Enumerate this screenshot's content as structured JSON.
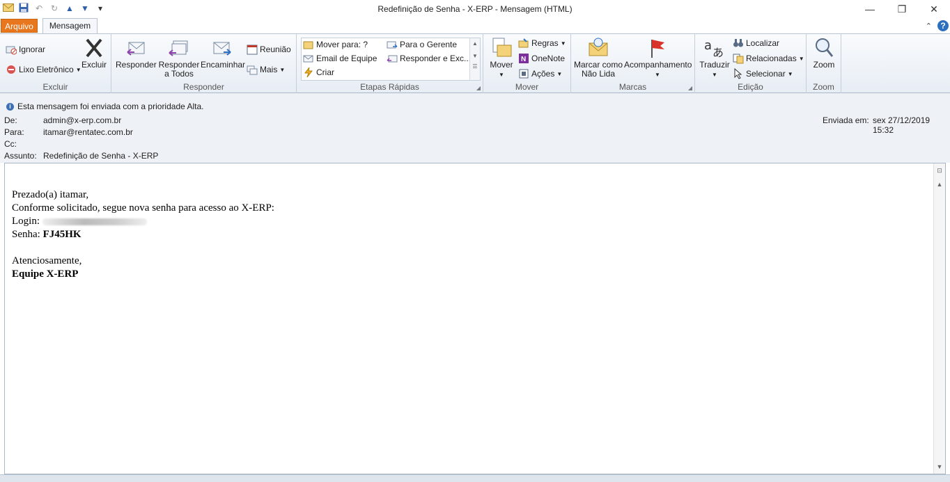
{
  "window": {
    "title": "Redefinição de Senha - X-ERP  -  Mensagem (HTML)"
  },
  "tabs": {
    "file": "Arquivo",
    "message": "Mensagem"
  },
  "ribbon": {
    "excluir": {
      "ignore": "Ignorar",
      "junk": "Lixo Eletrônico",
      "delete": "Excluir",
      "label": "Excluir"
    },
    "responder": {
      "reply": "Responder",
      "reply_all_1": "Responder",
      "reply_all_2": "a Todos",
      "forward": "Encaminhar",
      "meeting": "Reunião",
      "more": "Mais",
      "label": "Responder"
    },
    "quick_steps": {
      "move_to": "Mover para: ?",
      "team_email": "Email de Equipe",
      "create": "Criar",
      "to_manager": "Para o Gerente",
      "reply_delete": "Responder e Exc...",
      "label": "Etapas Rápidas"
    },
    "mover": {
      "move": "Mover",
      "rules": "Regras",
      "onenote": "OneNote",
      "actions": "Ações",
      "label": "Mover"
    },
    "marcas": {
      "mark_unread_1": "Marcar como",
      "mark_unread_2": "Não Lida",
      "followup": "Acompanhamento",
      "label": "Marcas"
    },
    "edicao": {
      "translate": "Traduzir",
      "find": "Localizar",
      "related": "Relacionadas",
      "select": "Selecionar",
      "label": "Edição"
    },
    "zoom": {
      "zoom": "Zoom",
      "label": "Zoom"
    }
  },
  "header": {
    "priority_notice": "Esta mensagem foi enviada com a prioridade Alta.",
    "from_label": "De:",
    "from_value": "admin@x-erp.com.br",
    "to_label": "Para:",
    "to_value": "itamar@rentatec.com.br",
    "cc_label": "Cc:",
    "subject_label": "Assunto:",
    "subject_value": "Redefinição de Senha - X-ERP",
    "sent_label": "Enviada em:",
    "sent_value": "sex 27/12/2019 15:32"
  },
  "body": {
    "greeting": "Prezado(a) itamar,",
    "line1": "Conforme solicitado, segue nova senha para acesso ao X-ERP:",
    "login_label": "Login:",
    "password_label": "Senha:",
    "password_value": "FJ45HK",
    "closing": "Atenciosamente,",
    "signature": "Equipe X-ERP"
  },
  "colors": {
    "file_tab": "#e8761c",
    "accent": "#2e6fc0"
  }
}
